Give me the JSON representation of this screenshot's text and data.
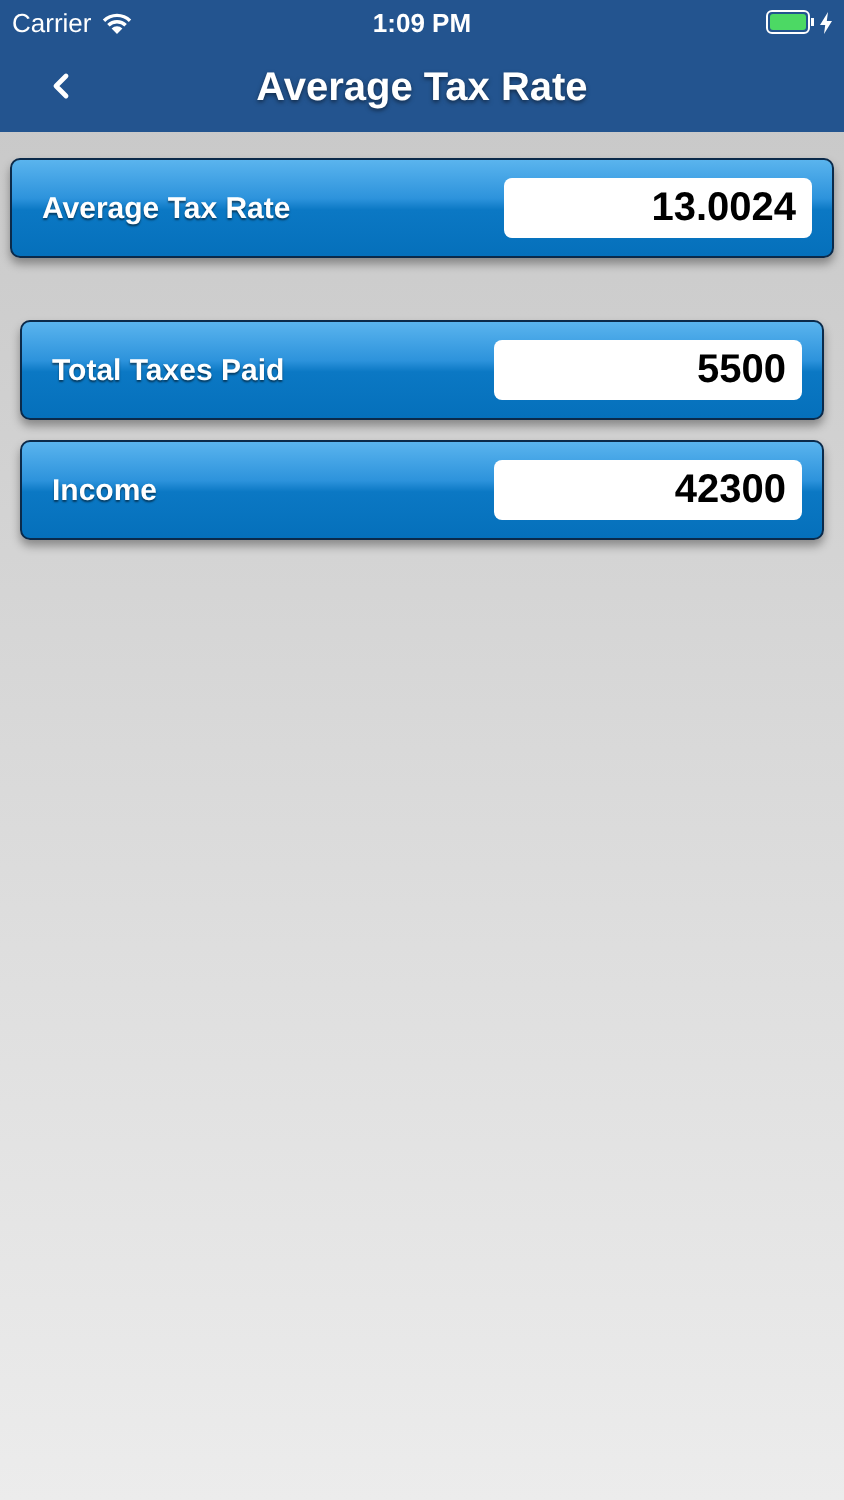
{
  "status_bar": {
    "carrier": "Carrier",
    "time": "1:09 PM"
  },
  "nav": {
    "title": "Average Tax Rate"
  },
  "result": {
    "label": "Average Tax Rate",
    "value": "13.0024"
  },
  "inputs": [
    {
      "label": "Total Taxes Paid",
      "value": "5500"
    },
    {
      "label": "Income",
      "value": "42300"
    }
  ]
}
